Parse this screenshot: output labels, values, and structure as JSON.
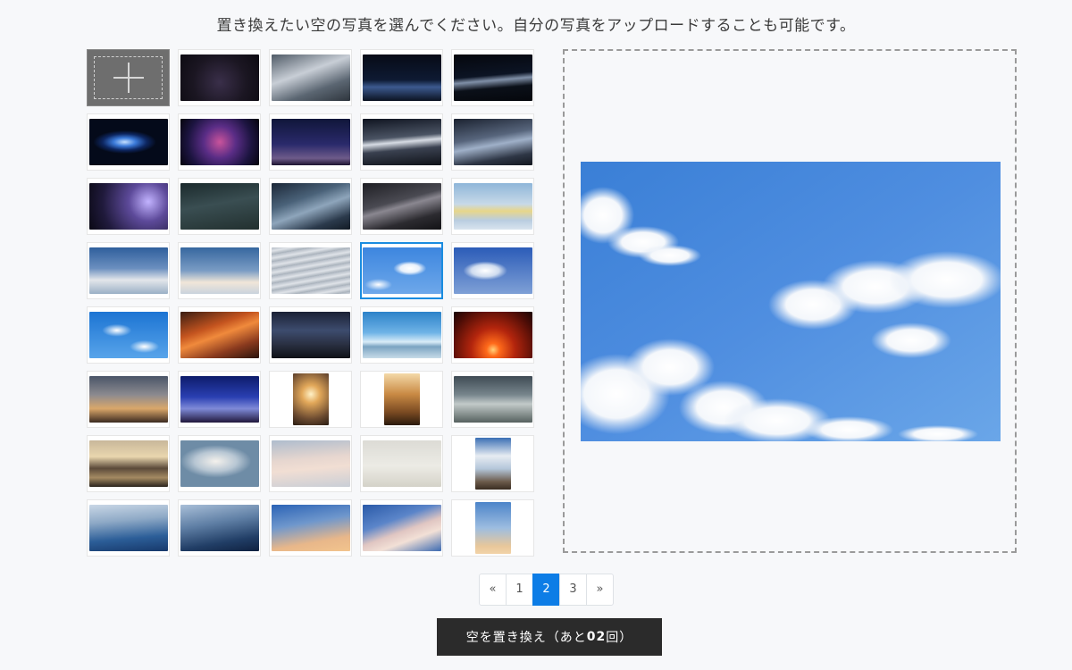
{
  "instruction": "置き換えたい空の写真を選んでください。自分の写真をアップロードすることも可能です。",
  "upload_tile": {
    "icon": "plus-icon"
  },
  "thumbnails": [
    {
      "name": "star-trails",
      "bg": "radial-gradient(circle at 50% 60%, #3a2f4a 0%, #1b1622 55%, #0d0b12 100%)"
    },
    {
      "name": "storm-clouds-gray",
      "bg": "linear-gradient(160deg, #4f5a66 0%, #c8ced6 40%, #5b6672 70%, #2e353d 100%)"
    },
    {
      "name": "night-glow-horizon",
      "bg": "linear-gradient(180deg, #070b16 0%, #0e1a33 55%, #3c5a8f 70%, #0b1220 100%)"
    },
    {
      "name": "milky-way-band",
      "bg": "linear-gradient(175deg, #05070d 0%, #0c1424 45%, #8090a8 55%, #0b1019 70%, #05070c 100%)"
    },
    {
      "name": "spiral-galaxy",
      "bg": "radial-gradient(ellipse 40% 25% at 45% 50%, #c4e0ff 0%, #3b7ad9 35%, #0d2660 70%, #040a1a 100%)"
    },
    {
      "name": "nebula",
      "bg": "radial-gradient(circle at 50% 50%, #c9539b 0%, #5a2d86 35%, #1c1440 70%, #06040d 100%)"
    },
    {
      "name": "meteor-sky",
      "bg": "linear-gradient(180deg, #10163a 0%, #2a2a6b 55%, #6e5b8a 85%, #1d1430 100%)"
    },
    {
      "name": "lightning-city",
      "bg": "linear-gradient(175deg, #0f1420 0%, #4b5464 40%, #d7dce4 50%, #3a4150 65%, #0f1218 100%)"
    },
    {
      "name": "lightning-blue",
      "bg": "linear-gradient(170deg, #1b2230 0%, #57657c 40%, #9fb0c8 55%, #2e3645 80%, #141820 100%)"
    },
    {
      "name": "purple-lightning",
      "bg": "radial-gradient(circle at 75% 40%, #c2b3ff 0%, #5d4a9a 30%, #201a3c 70%, #0a0914 100%)"
    },
    {
      "name": "dark-teal-storm",
      "bg": "linear-gradient(170deg, #1b2a2c 0%, #3a4e52 45%, #22302f 100%)"
    },
    {
      "name": "blue-storm",
      "bg": "linear-gradient(160deg, #1c2838 0%, #4a6279 35%, #8ea5bb 55%, #2b3a4c 80%, #111a24 100%)"
    },
    {
      "name": "dark-lightning",
      "bg": "linear-gradient(165deg, #1f1f24 0%, #4a4a52 40%, #8a8790 50%, #2c2b30 75%, #121215 100%)"
    },
    {
      "name": "rainbow",
      "bg": "linear-gradient(180deg, #8fb6d9 0%, #c7d9e8 45%, #e8d68a 60%, #b9cde0 80%, #d9e4ee 100%)"
    },
    {
      "name": "cloud-bank-blue",
      "bg": "linear-gradient(180deg, #2f5f9c 0%, #6b8fbf 45%, #e3e6ea 70%, #9bb0c6 100%)"
    },
    {
      "name": "cloud-bank-warm",
      "bg": "linear-gradient(180deg, #36679f 0%, #7a9cc4 50%, #f0e6d8 75%, #c9d3dd 100%)"
    },
    {
      "name": "mackerel-clouds",
      "bg": "repeating-linear-gradient(170deg, #b4bcc6 0px, #dfe3e8 4px, #a7b0ba 8px)"
    },
    {
      "name": "blue-sky-clouds",
      "bg": "radial-gradient(ellipse 30% 22% at 60% 45%, #ffffff 0%, #e9f1fb 40%, transparent 70%), radial-gradient(ellipse 25% 18% at 20% 80%, #ffffff 0%, transparent 70%), linear-gradient(180deg, #3d86df 0%, #6ea8ea 100%)"
    },
    {
      "name": "blue-sky-cumulus",
      "bg": "radial-gradient(ellipse 35% 25% at 40% 50%, #ffffff 0%, #cfdcef 50%, transparent 80%), linear-gradient(180deg, #2b5cb8 0%, #7fa0d6 100%)"
    },
    {
      "name": "puffy-clouds",
      "bg": "radial-gradient(ellipse 25% 18% at 35% 40%, #ffffff 0%, transparent 75%), radial-gradient(ellipse 25% 18% at 70% 75%, #ffffff 0%, transparent 75%), linear-gradient(180deg, #1c74d3 0%, #58a4ea 100%)"
    },
    {
      "name": "orange-sunset-clouds",
      "bg": "linear-gradient(160deg, #3a1d12 0%, #c4541f 35%, #f08a3c 50%, #8a3a1e 75%, #2a130c 100%)"
    },
    {
      "name": "dark-forest-sky",
      "bg": "linear-gradient(180deg, #1b2135 0%, #3d4c6e 40%, #2a3042 70%, #0f1116 100%)"
    },
    {
      "name": "ocean-horizon",
      "bg": "linear-gradient(180deg, #2c82c9 0%, #6fb3e6 45%, #d9ecf7 65%, #7ba4c2 75%, #c7dbe8 100%)"
    },
    {
      "name": "red-sunset",
      "bg": "radial-gradient(circle at 50% 82%, #ffd27a 0%, #ff6a1a 12%, #b3250d 40%, #4a0c06 80%, #1a0503 100%)"
    },
    {
      "name": "dusk-horizon",
      "bg": "linear-gradient(180deg, #4a5568 0%, #8b8a8f 40%, #d9a76a 70%, #3b2a20 100%)"
    },
    {
      "name": "twilight-blue",
      "bg": "linear-gradient(180deg, #0d1c6b 0%, #2a3fb2 45%, #7f8ad8 70%, #21183c 100%)"
    },
    {
      "name": "sun-through-clouds-portrait",
      "portrait": true,
      "bg": "radial-gradient(circle at 50% 40%, #fff1c6 0%, #e2a85a 25%, #6b4a30 70%, #2a1d13 100%)"
    },
    {
      "name": "sunbeams-portrait",
      "portrait": true,
      "bg": "linear-gradient(180deg, #f4d9a8 0%, #c98a44 40%, #7a4a22 75%, #2b1a0d 100%)"
    },
    {
      "name": "god-rays",
      "bg": "linear-gradient(180deg, #3f4b54 0%, #77858c 40%, #c2cac9 60%, #56615f 100%)"
    },
    {
      "name": "golden-clouds",
      "bg": "linear-gradient(180deg, #c8b79a 0%, #e9d6ae 35%, #5b4a3a 60%, #a48a62 80%, #2a241d 100%)"
    },
    {
      "name": "wispy-clouds",
      "bg": "radial-gradient(ellipse 45% 35% at 45% 45%, #f4f1ec 0%, #b7c6d3 60%, #6e8ca6 100%)"
    },
    {
      "name": "pastel-streaks",
      "bg": "linear-gradient(175deg, #aebccd 0%, #e6d6cf 40%, #f1ded3 60%, #c9ced6 100%)"
    },
    {
      "name": "bird-sky",
      "bg": "linear-gradient(180deg, #dcdbd5 0%, #ecebe5 55%, #d4d2c8 100%)"
    },
    {
      "name": "canyon-clouds-portrait",
      "portrait": true,
      "bg": "linear-gradient(180deg, #3a6fb5 0%, #e7ecf2 35%, #b4c6da 60%, #6b5a4a 85%, #3a2d22 100%)"
    },
    {
      "name": "blue-cirrus",
      "bg": "linear-gradient(175deg, #c9d7e6 0%, #8ea9c6 35%, #2c5e98 70%, #17396b 100%)"
    },
    {
      "name": "deep-blue-clouds",
      "bg": "linear-gradient(170deg, #a9bfd8 0%, #5f7fa5 40%, #213e66 75%, #0f2140 100%)"
    },
    {
      "name": "sunset-cirrus",
      "bg": "linear-gradient(170deg, #2b63b6 0%, #6f97cc 40%, #e8b78a 75%, #f2c48d 100%)"
    },
    {
      "name": "pink-cirrus",
      "bg": "linear-gradient(160deg, #2a5aa8 0%, #5b85c9 35%, #e0c6c2 55%, #f2e0d6 70%, #3c6ab1 100%)"
    },
    {
      "name": "dawn-portrait",
      "portrait": true,
      "bg": "linear-gradient(180deg, #4c84c9 0%, #9dbde0 50%, #e8c79a 85%, #f2d3a8 100%)"
    }
  ],
  "preview_alt": "blue-sky-preview",
  "pagination": {
    "prev": "«",
    "pages": [
      "1",
      "2",
      "3"
    ],
    "next": "»",
    "active_page": "2"
  },
  "action": {
    "prefix": "空を置き換え（あと",
    "count": "02",
    "suffix": "回）"
  },
  "colors": {
    "background": "#f7f8fa",
    "accent": "#0d7de6",
    "button": "#2b2b2b"
  }
}
